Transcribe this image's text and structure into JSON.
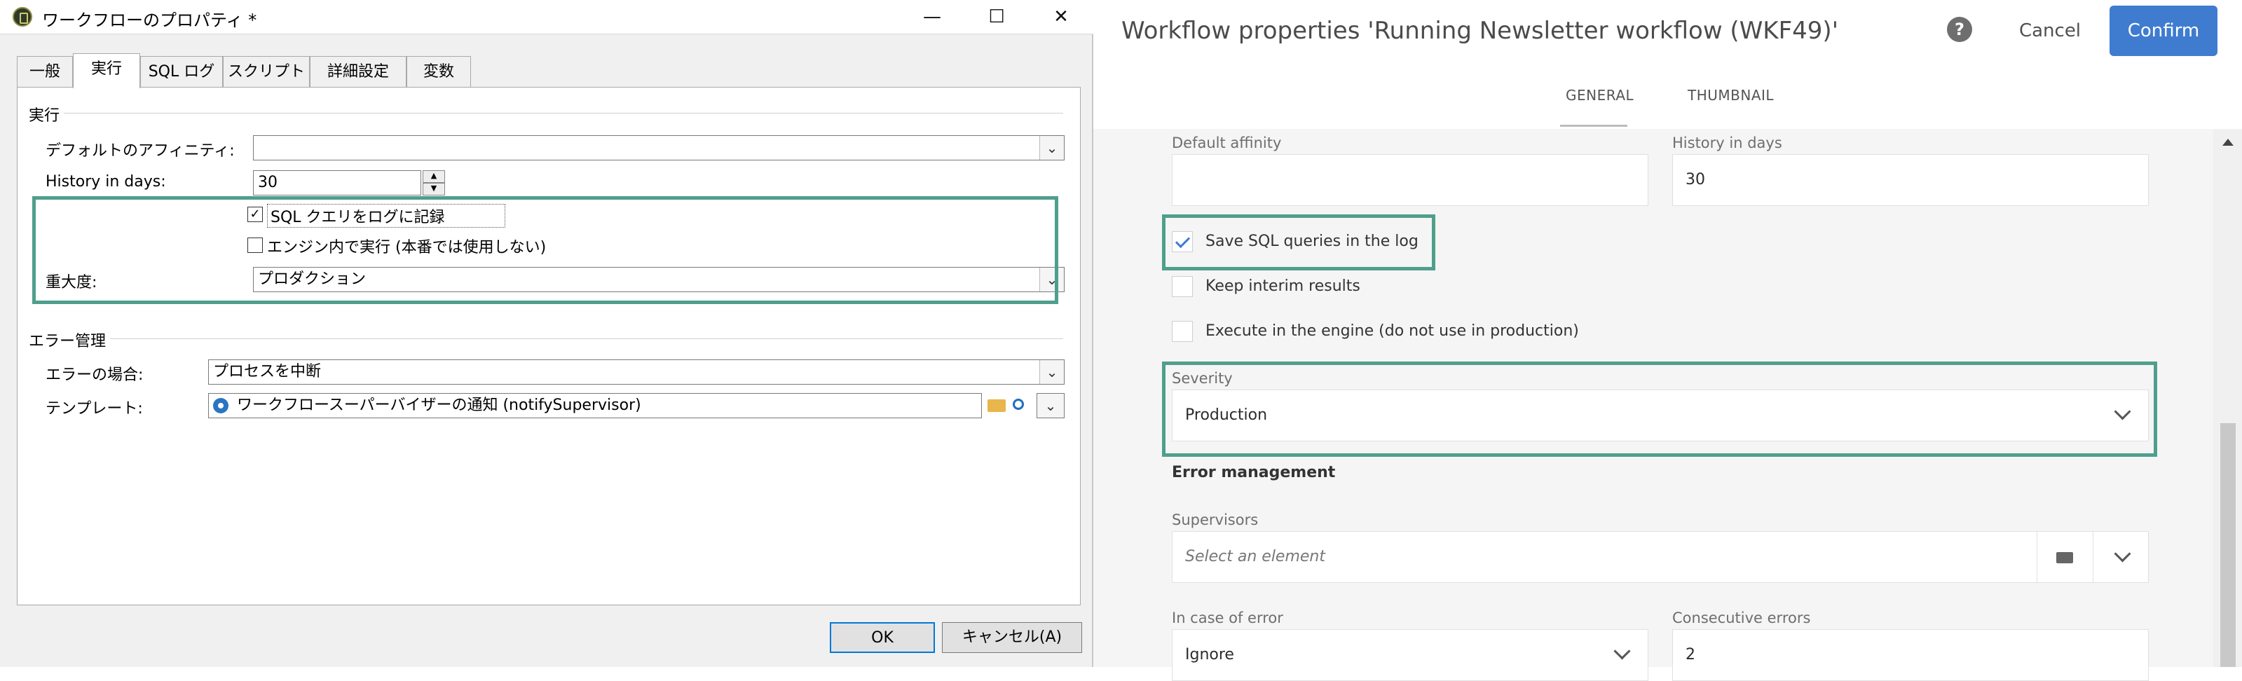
{
  "left": {
    "window_title": "ワークフローのプロパティ *",
    "window_controls": {
      "minimize": "—",
      "maximize": "☐",
      "close": "✕"
    },
    "tabs": [
      "一般",
      "実行",
      "SQL ログ",
      "スクリプト",
      "詳細設定",
      "変数"
    ],
    "active_tab": "実行",
    "execution": {
      "group_label": "実行",
      "affinity_label": "デフォルトのアフィニティ:",
      "affinity_value": "",
      "history_label": "History in days:",
      "history_value": "30",
      "log_sql_label": "SQL クエリをログに記録",
      "log_sql_checked": true,
      "in_engine_label": "エンジン内で実行 (本番では使用しない)",
      "in_engine_checked": false,
      "severity_label": "重大度:",
      "severity_value": "プロダクション"
    },
    "error_management": {
      "group_label": "エラー管理",
      "on_error_label": "エラーの場合:",
      "on_error_value": "プロセスを中断",
      "template_label": "テンプレート:",
      "template_value": "ワークフロースーパーバイザーの通知 (notifySupervisor)"
    },
    "buttons": {
      "ok": "OK",
      "cancel": "キャンセル(A)"
    },
    "highlight_color": "#4f9f8d"
  },
  "right": {
    "title": "Workflow properties 'Running Newsletter workflow (WKF49)'",
    "help": "?",
    "cancel": "Cancel",
    "confirm": "Confirm",
    "tabs": [
      "GENERAL",
      "THUMBNAIL"
    ],
    "active_tab": "GENERAL",
    "default_affinity_label": "Default affinity",
    "default_affinity_value": "",
    "history_label": "History in days",
    "history_value": "30",
    "save_sql_label": "Save SQL queries in the log",
    "save_sql_checked": true,
    "keep_interim_label": "Keep interim results",
    "keep_interim_checked": false,
    "execute_engine_label": "Execute in the engine (do not use in production)",
    "execute_engine_checked": false,
    "severity_label": "Severity",
    "severity_value": "Production",
    "error_management_label": "Error management",
    "supervisors_label": "Supervisors",
    "supervisors_placeholder": "Select an element",
    "in_case_of_error_label": "In case of error",
    "in_case_of_error_value": "Ignore",
    "consecutive_errors_label": "Consecutive errors",
    "consecutive_errors_value": "2",
    "accent_color": "#3f7cd0"
  }
}
